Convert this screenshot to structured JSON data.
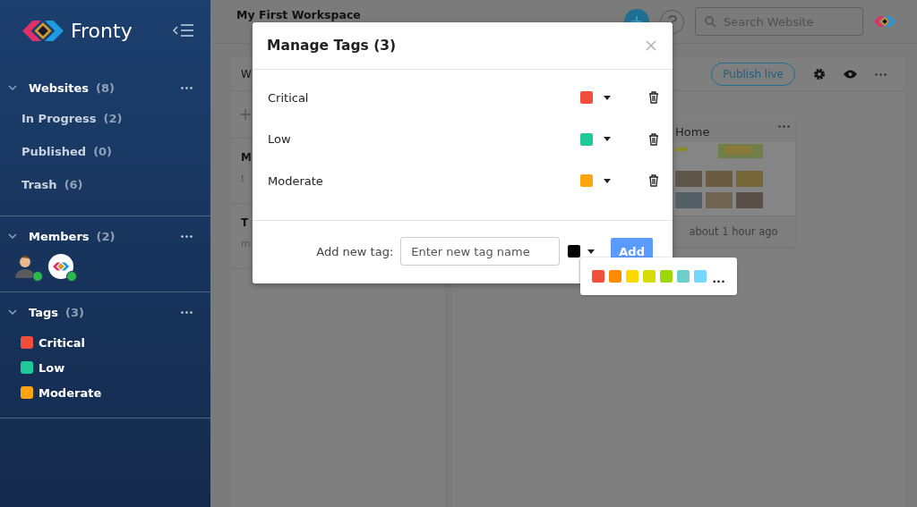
{
  "sidebar": {
    "logo": "Fronty",
    "websites": {
      "title": "Websites",
      "count": "(8)",
      "expanded": true,
      "items": [
        {
          "label": "In Progress",
          "count": "(2)"
        },
        {
          "label": "Published",
          "count": "(0)"
        },
        {
          "label": "Trash",
          "count": "(6)"
        }
      ]
    },
    "members": {
      "title": "Members",
      "count": "(2)",
      "expanded": true,
      "items": [
        {
          "kind": "person",
          "online": true
        },
        {
          "kind": "logo",
          "online": true
        }
      ]
    },
    "tags": {
      "title": "Tags",
      "count": "(3)",
      "expanded": true,
      "items": [
        {
          "label": "Critical",
          "color": "#f24e3d"
        },
        {
          "label": "Low",
          "color": "#1fc99a"
        },
        {
          "label": "Moderate",
          "color": "#fea40f"
        }
      ]
    }
  },
  "header": {
    "workspace_title": "My First Workspace",
    "search": {
      "placeholder": "Search Website"
    }
  },
  "board": {
    "tab": "W",
    "publish_button": "Publish live",
    "cards": [
      {
        "title": "M",
        "subtitle": "t"
      },
      {
        "title": "T",
        "subtitle": "m"
      }
    ],
    "website_card": {
      "title": "Home",
      "time": "about 1 hour ago"
    }
  },
  "modal": {
    "title": "Manage Tags (3)",
    "tags": [
      {
        "label": "Critical",
        "color": "#f24e3d"
      },
      {
        "label": "Low",
        "color": "#1fc99a"
      },
      {
        "label": "Moderate",
        "color": "#fea40f"
      }
    ],
    "add_label": "Add new tag:",
    "field": {
      "placeholder": "Enter new tag name"
    },
    "new_tag": {
      "color": "#000000"
    },
    "add_button": "Add"
  },
  "palette": {
    "colors": [
      {
        "color": "#f44f3a"
      },
      {
        "color": "#ff8c00"
      },
      {
        "color": "#ffd800"
      },
      {
        "color": "#d6dc00"
      },
      {
        "color": "#9fd80a"
      },
      {
        "color": "#6ccfcc"
      },
      {
        "color": "#77d8ff"
      }
    ],
    "more": "..."
  }
}
